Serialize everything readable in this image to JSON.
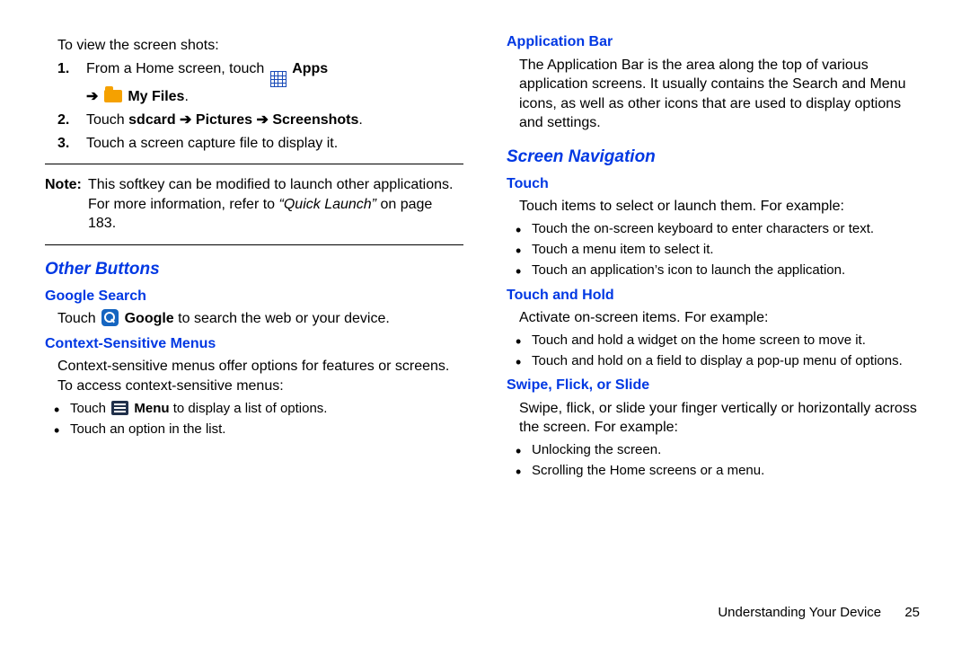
{
  "left": {
    "intro": "To view the screen shots:",
    "step1_a": "From a Home screen, touch ",
    "step1_apps": " Apps",
    "step1_arrow": "➔",
    "step1_myfiles": " My Files",
    "step1_dot": ".",
    "step2_a": "Touch ",
    "step2_b": "sdcard ➔ Pictures ➔ Screenshots",
    "step2_c": ".",
    "step3": "Touch a screen capture file to display it.",
    "note_lbl": "Note:",
    "note_a": "This softkey can be modified to launch other applications. For more information, refer to ",
    "note_b": "“Quick Launch”",
    "note_c": " on page 183.",
    "h2_other": "Other Buttons",
    "h3_google": "Google Search",
    "google_a": "Touch ",
    "google_b": " Google",
    "google_c": " to search the web or your device.",
    "h3_ctx": "Context-Sensitive Menus",
    "ctx_p": "Context-sensitive menus offer options for features or screens. To access context-sensitive menus:",
    "ctx_li1_a": "Touch ",
    "ctx_li1_b": " Menu",
    "ctx_li1_c": " to display a list of options.",
    "ctx_li2": "Touch an option in the list."
  },
  "right": {
    "h3_app": "Application Bar",
    "app_p": "The Application Bar is the area along the top of various application screens. It usually contains the Search and Menu icons, as well as other icons that are used to display options and settings.",
    "h2_nav": "Screen Navigation",
    "h3_touch": "Touch",
    "touch_p": "Touch items to select or launch them. For example:",
    "touch_li1": "Touch the on-screen keyboard to enter characters or text.",
    "touch_li2": "Touch a menu item to select it.",
    "touch_li3": "Touch an application’s icon to launch the application.",
    "h3_hold": "Touch and Hold",
    "hold_p": "Activate on-screen items. For example:",
    "hold_li1": "Touch and hold a widget on the home screen to move it.",
    "hold_li2": "Touch and hold on a field to display a pop-up menu of options.",
    "h3_swipe": "Swipe, Flick, or Slide",
    "swipe_p": "Swipe, flick, or slide your finger vertically or horizontally across the screen. For example:",
    "swipe_li1": "Unlocking the screen.",
    "swipe_li2": "Scrolling the Home screens or a menu."
  },
  "footer": {
    "section": "Understanding Your Device",
    "page": "25"
  }
}
